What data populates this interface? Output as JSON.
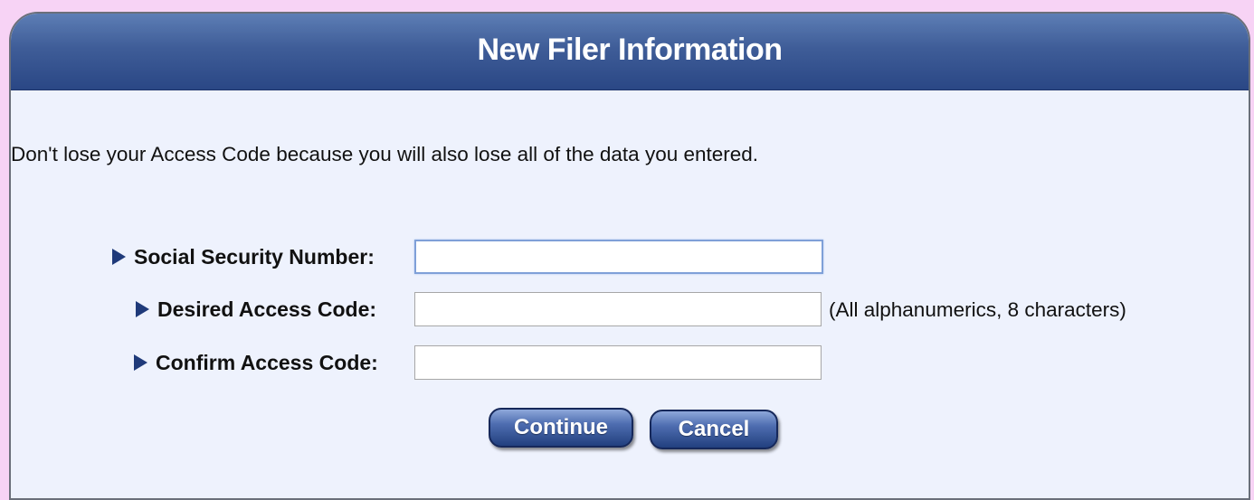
{
  "panel": {
    "title": "New Filer Information"
  },
  "notice": "Don't lose your Access Code because you will also lose all of the data you entered.",
  "form": {
    "ssn": {
      "label": "Social Security Number:",
      "value": ""
    },
    "desired_code": {
      "label": "Desired Access Code:",
      "value": "",
      "hint": "(All alphanumerics, 8 characters)"
    },
    "confirm_code": {
      "label": "Confirm Access Code:",
      "value": ""
    }
  },
  "buttons": {
    "continue_label": "Continue",
    "cancel_label": "Cancel"
  },
  "icons": {
    "row_marker": "triangle-right-icon"
  },
  "colors": {
    "page_background": "#f7d3f5",
    "panel_background": "#eef2fd",
    "header_blue": "#3f5d98",
    "button_blue": "#22407f",
    "marker": "#1f3a7a"
  }
}
